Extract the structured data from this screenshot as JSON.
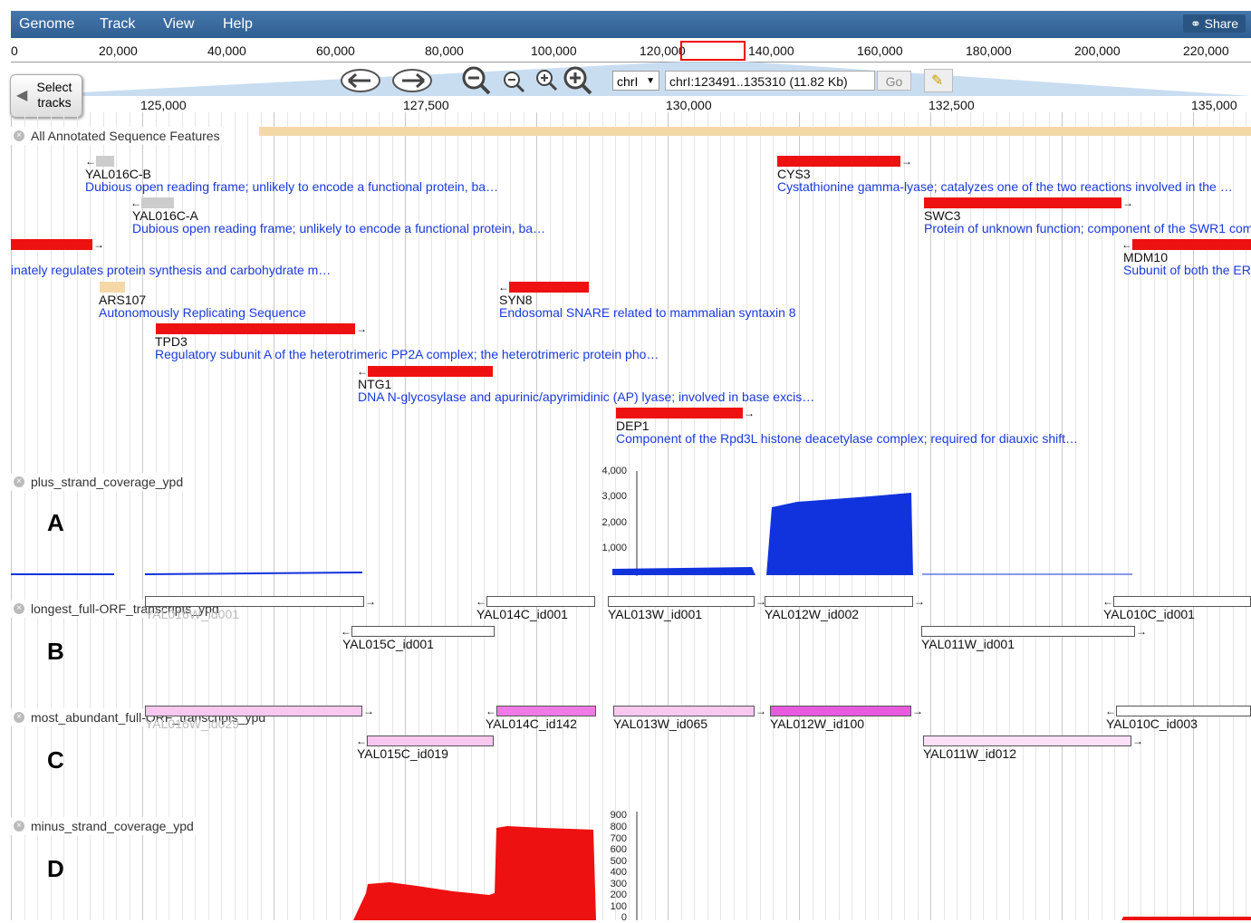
{
  "menu": {
    "genome": "Genome",
    "track": "Track",
    "view": "View",
    "help": "Help",
    "share": "Share"
  },
  "overview": {
    "ticks": [
      "0",
      "20,000",
      "40,000",
      "60,000",
      "80,000",
      "100,000",
      "120,000",
      "140,000",
      "160,000",
      "180,000",
      "200,000",
      "220,000"
    ]
  },
  "nav": {
    "select_tracks": "Select tracks",
    "refseq": "chrI",
    "location": "chrI:123491..135310 (11.82 Kb)",
    "go": "Go"
  },
  "ruler": {
    "ticks": [
      "125,000",
      "127,500",
      "130,000",
      "132,500",
      "135,000"
    ]
  },
  "tracks": {
    "annot": "All Annotated Sequence Features",
    "plus": "plus_strand_coverage_ypd",
    "longest": "longest_full-ORF_transcripts_ypd",
    "abundant": "most_abundant_full-ORF_transcripts_ypd",
    "minus": "minus_strand_coverage_ypd"
  },
  "features": [
    {
      "name": "YAL016C-B",
      "desc": "Dubious open reading frame; unlikely to encode a functional protein, ba…",
      "color": "#cccccc"
    },
    {
      "name": "YAL016C-A",
      "desc": "Dubious open reading frame; unlikely to encode a functional protein, ba…",
      "color": "#cccccc"
    },
    {
      "name": "",
      "desc": "inately regulates protein synthesis and carbohydrate m…",
      "color": "#ee1111"
    },
    {
      "name": "ARS107",
      "desc": "Autonomously Replicating Sequence",
      "color": "#f5d8a8"
    },
    {
      "name": "TPD3",
      "desc": "Regulatory subunit A of the heterotrimeric PP2A complex; the heterotrimeric protein pho…",
      "color": "#ee1111"
    },
    {
      "name": "NTG1",
      "desc": "DNA N-glycosylase and apurinic/apyrimidinic (AP) lyase; involved in base excis…",
      "color": "#ee1111"
    },
    {
      "name": "SYN8",
      "desc": "Endosomal SNARE related to mammalian syntaxin 8",
      "color": "#ee1111"
    },
    {
      "name": "DEP1",
      "desc": "Component of the Rpd3L histone deacetylase complex; required for diauxic shift…",
      "color": "#ee1111"
    },
    {
      "name": "CYS3",
      "desc": "Cystathionine gamma-lyase; catalyzes one of the two reactions involved in the …",
      "color": "#ee1111"
    },
    {
      "name": "SWC3",
      "desc": "Protein of unknown function; component of the SWR1 com",
      "color": "#ee1111"
    },
    {
      "name": "MDM10",
      "desc": "Subunit of both the ER",
      "color": "#ee1111"
    }
  ],
  "panels": {
    "a": "A",
    "b": "B",
    "c": "C",
    "d": "D"
  },
  "longest_tx": [
    "YAL016W_id001",
    "YAL015C_id001",
    "YAL014C_id001",
    "YAL013W_id001",
    "YAL012W_id002",
    "YAL011W_id001",
    "YAL010C_id001"
  ],
  "abundant_tx": [
    "YAL016W_id029",
    "YAL015C_id019",
    "YAL014C_id142",
    "YAL013W_id065",
    "YAL012W_id100",
    "YAL011W_id012",
    "YAL010C_id003"
  ],
  "plus_axis": [
    "4,000",
    "3,000",
    "2,000",
    "1,000"
  ],
  "minus_axis": [
    "900",
    "800",
    "700",
    "600",
    "500",
    "400",
    "300",
    "200",
    "100",
    "0"
  ],
  "colors": {
    "plus": "#1133dd",
    "minus": "#ee1111",
    "menubar": "#3a6b9e",
    "highlight": "#ee0000"
  }
}
